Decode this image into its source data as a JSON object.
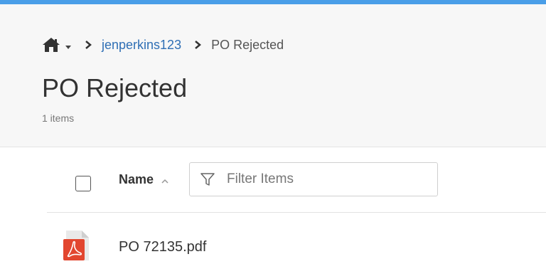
{
  "breadcrumb": {
    "home_icon": "home-icon",
    "user_link": "jenperkins123",
    "current": "PO Rejected"
  },
  "header": {
    "title": "PO Rejected",
    "item_count": "1 items"
  },
  "list_header": {
    "name_label": "Name",
    "sort_direction": "ascending",
    "filter_placeholder": "Filter Items",
    "filter_value": ""
  },
  "files": [
    {
      "name": "PO 72135.pdf",
      "type_icon": "pdf-icon"
    }
  ],
  "colors": {
    "accent_bar": "#4a9ee8",
    "link": "#2f6fb5",
    "pdf_red": "#e2462f"
  }
}
